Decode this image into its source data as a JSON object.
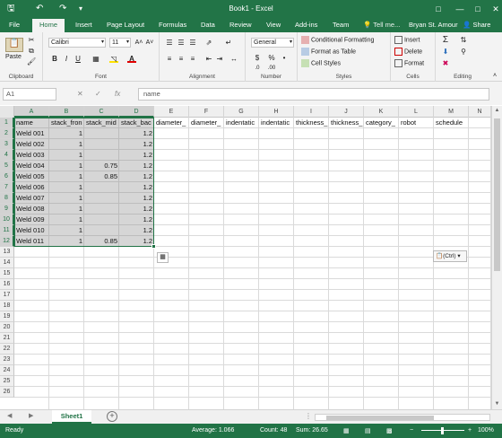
{
  "app": {
    "title": "Book1 - Excel",
    "user": "Bryan St. Amour",
    "share_label": "Share",
    "tell_me": "Tell me...",
    "minimize": "—",
    "maximize": "□",
    "close": "✕"
  },
  "quick_access": {
    "save_icon": "🖫",
    "undo_icon": "↶",
    "redo_icon": "↷",
    "customize_icon": "▾"
  },
  "tabs": [
    "File",
    "Home",
    "Insert",
    "Page Layout",
    "Formulas",
    "Data",
    "Review",
    "View",
    "Add-ins",
    "Team"
  ],
  "ribbon": {
    "clipboard": {
      "label": "Clipboard",
      "paste": "Paste"
    },
    "font": {
      "label": "Font",
      "name": "Calibri",
      "size": "11",
      "bold": "B",
      "italic": "I",
      "underline": "U"
    },
    "alignment": {
      "label": "Alignment"
    },
    "number": {
      "label": "Number",
      "format": "General",
      "currency": "$",
      "percent": "%",
      "comma": "•"
    },
    "styles": {
      "label": "Styles",
      "conditional": "Conditional Formatting",
      "table": "Format as Table",
      "cell_styles": "Cell Styles"
    },
    "cells": {
      "label": "Cells",
      "insert": "Insert",
      "delete": "Delete",
      "format": "Format"
    },
    "editing": {
      "label": "Editing"
    }
  },
  "formula_bar": {
    "name_box": "A1",
    "fx": "fx",
    "content": "name"
  },
  "grid": {
    "columns": [
      "A",
      "B",
      "C",
      "D",
      "E",
      "F",
      "G",
      "H",
      "I",
      "J",
      "K",
      "L",
      "M",
      "N"
    ],
    "selected_columns": [
      "A",
      "B",
      "C",
      "D"
    ],
    "row_numbers": [
      "1",
      "2",
      "3",
      "4",
      "5",
      "6",
      "7",
      "8",
      "9",
      "10",
      "11",
      "12",
      "13",
      "14",
      "15",
      "16",
      "17",
      "18",
      "19",
      "20",
      "21",
      "22",
      "23",
      "24",
      "25",
      "26"
    ],
    "selected_rows": 12,
    "header_row": [
      "name",
      "stack_fron",
      "stack_mid",
      "stack_bac",
      "diameter_",
      "diameter_",
      "indentatic",
      "indentatic",
      "thickness_",
      "thickness_",
      "category_",
      "robot",
      "schedule",
      ""
    ],
    "data_rows": [
      [
        "Weld 001",
        "1",
        "",
        "1.2"
      ],
      [
        "Weld 002",
        "1",
        "",
        "1.2"
      ],
      [
        "Weld 003",
        "1",
        "",
        "1.2"
      ],
      [
        "Weld 004",
        "1",
        "0.75",
        "1.2"
      ],
      [
        "Weld 005",
        "1",
        "0.85",
        "1.2"
      ],
      [
        "Weld 006",
        "1",
        "",
        "1.2"
      ],
      [
        "Weld 007",
        "1",
        "",
        "1.2"
      ],
      [
        "Weld 008",
        "1",
        "",
        "1.2"
      ],
      [
        "Weld 009",
        "1",
        "",
        "1.2"
      ],
      [
        "Weld 010",
        "1",
        "",
        "1.2"
      ],
      [
        "Weld 011",
        "1",
        "0.85",
        "1.2"
      ]
    ],
    "paste_ctrl": "(Ctrl)"
  },
  "sheets": {
    "tabs": [
      "Sheet1"
    ],
    "add": "+"
  },
  "status": {
    "ready": "Ready",
    "average": "Average: 1.066",
    "count": "Count: 48",
    "sum": "Sum: 26.65",
    "zoom": "100%"
  }
}
